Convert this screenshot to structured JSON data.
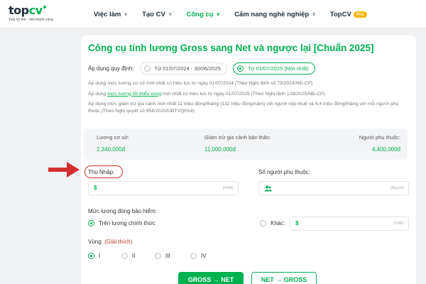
{
  "nav": {
    "logo_main_a": "top",
    "logo_main_b": "cv",
    "logo_sub": "Tiếp lợi thế - Nối thành công",
    "items": [
      {
        "label": "Việc làm",
        "active": false
      },
      {
        "label": "Tạo CV",
        "active": false
      },
      {
        "label": "Công cụ",
        "active": true
      },
      {
        "label": "Cẩm nang nghề nghiệp",
        "active": false
      },
      {
        "label": "TopCV",
        "active": false
      }
    ],
    "pro_badge": "Pro"
  },
  "calculator": {
    "title": "Công cụ tính lương Gross sang Net và ngược lại [Chuẩn 2025]",
    "apply_label": "Áp dụng quy định:",
    "period_old": "Từ 01/07/2024 - 30/06/2025",
    "period_new": "Từ 01/07/2025 (Mới nhất)",
    "note1": "Áp dụng mức lương cơ sở mới nhất có hiệu lực từ ngày 01/07/2024 (Theo Nghị định số 73/2024/NĐ-CP)",
    "note2_prefix": "Áp dụng ",
    "note2_link": "mức lương tối thiểu vùng",
    "note2_suffix": " mới nhất có hiệu lực từ ngày 01/07/2025 (Theo Nghị định 128/2025/NĐ-CP)",
    "note3": "Áp dụng mức giảm trừ gia cảnh mới nhất 11 triệu đồng/tháng (132 triệu đồng/năm) với người nộp thuế và 4,4 triệu đồng/tháng với mỗi người phụ thuộc (Theo Nghị quyết số 954/2020/UBTVQH14)",
    "info": {
      "base_label": "Lương cơ sở:",
      "base_value": "2,340,000đ",
      "family_label": "Giảm trừ gia cảnh bản thân:",
      "family_value": "11,000,000đ",
      "dependent_label": "Người phụ thuộc:",
      "dependent_value": "4,400,000đ"
    },
    "income_label": "Thu Nhập:",
    "income_prefix": "$",
    "income_unit": "(VNĐ)",
    "dependents_label": "Số người phụ thuộc:",
    "dependents_unit": "(Người)",
    "insurance_label": "Mức lương đóng bảo hiểm:",
    "insurance_official": "Trên lương chính thức",
    "insurance_other": "Khác:",
    "insurance_prefix": "$",
    "insurance_unit": "(VNĐ)",
    "region_label": "Vùng:",
    "region_hint": "(Giải thích)",
    "regions": [
      "I",
      "II",
      "III",
      "IV"
    ],
    "btn_gross_net": "GROSS → NET",
    "btn_net_gross": "NET → GROSS"
  },
  "colors": {
    "brand_green": "#00b14f",
    "annotation_red": "#c0392b"
  }
}
